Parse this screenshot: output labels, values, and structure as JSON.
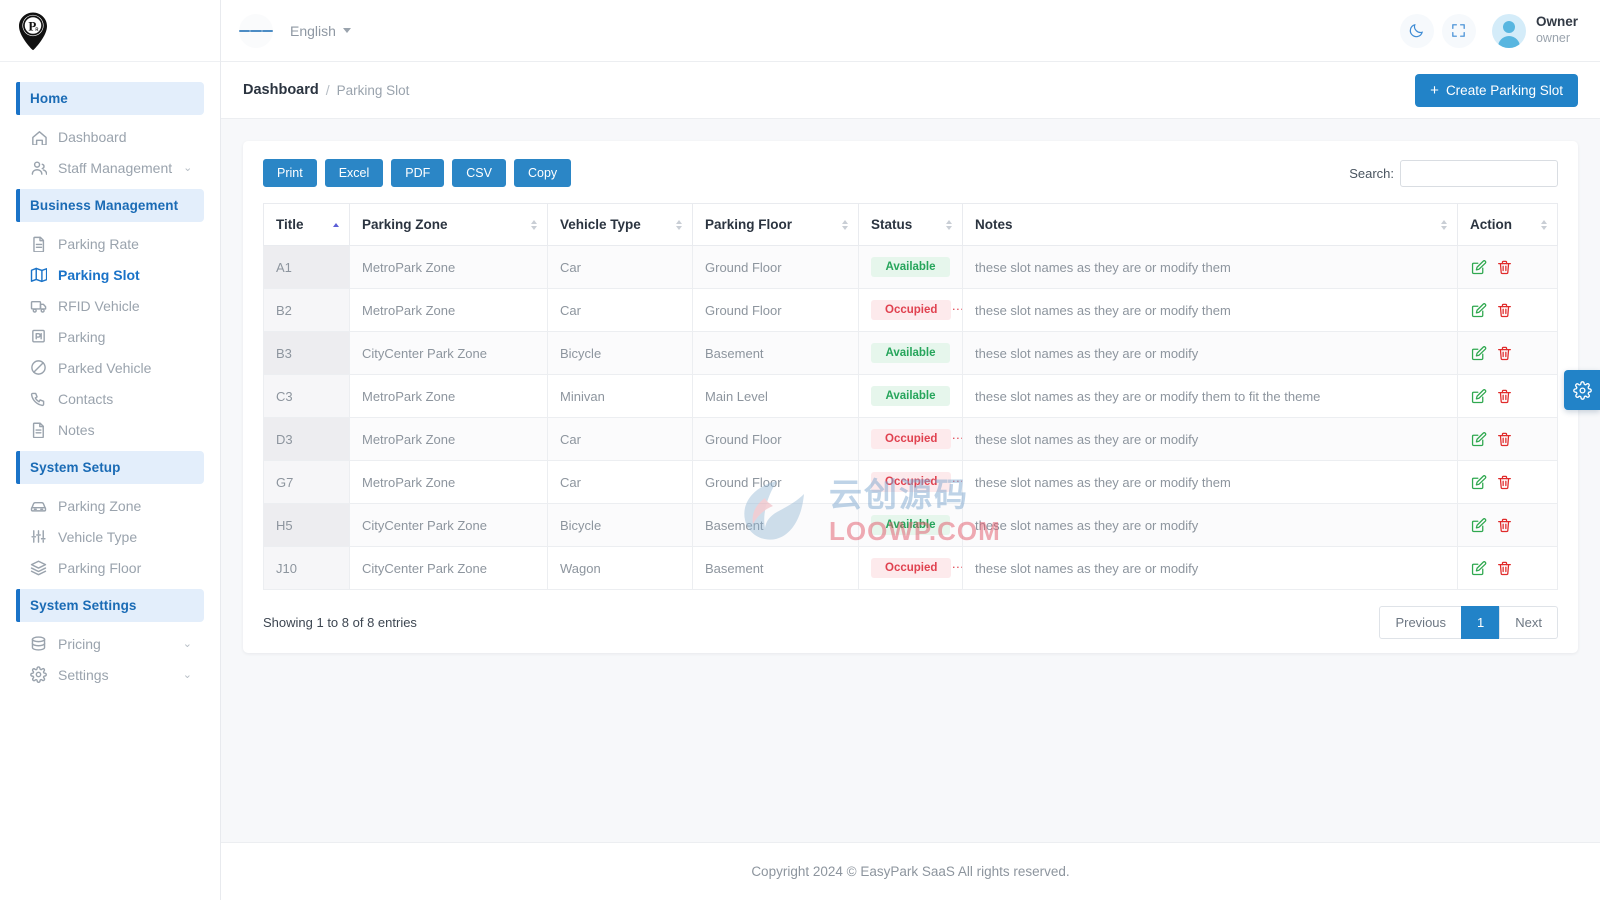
{
  "brand": {
    "logo_alt": "EasyPark parking pin logo"
  },
  "sidebar": {
    "groups": [
      {
        "label": "Home",
        "type": "section"
      },
      {
        "label": "Dashboard",
        "type": "item",
        "icon": "home-icon",
        "active": false,
        "caret": false
      },
      {
        "label": "Staff Management",
        "type": "item",
        "icon": "users-icon",
        "active": false,
        "caret": true
      },
      {
        "label": "Business Management",
        "type": "section"
      },
      {
        "label": "Parking Rate",
        "type": "item",
        "icon": "document-icon",
        "active": false,
        "caret": false
      },
      {
        "label": "Parking Slot",
        "type": "item",
        "icon": "map-icon",
        "active": true,
        "caret": false
      },
      {
        "label": "RFID Vehicle",
        "type": "item",
        "icon": "truck-icon",
        "active": false,
        "caret": false
      },
      {
        "label": "Parking",
        "type": "item",
        "icon": "parking-meter-icon",
        "active": false,
        "caret": false
      },
      {
        "label": "Parked Vehicle",
        "type": "item",
        "icon": "no-entry-icon",
        "active": false,
        "caret": false
      },
      {
        "label": "Contacts",
        "type": "item",
        "icon": "phone-icon",
        "active": false,
        "caret": false
      },
      {
        "label": "Notes",
        "type": "item",
        "icon": "note-icon",
        "active": false,
        "caret": false
      },
      {
        "label": "System Setup",
        "type": "section"
      },
      {
        "label": "Parking Zone",
        "type": "item",
        "icon": "car-icon",
        "active": false,
        "caret": false
      },
      {
        "label": "Vehicle Type",
        "type": "item",
        "icon": "sliders-icon",
        "active": false,
        "caret": false
      },
      {
        "label": "Parking Floor",
        "type": "item",
        "icon": "layers-icon",
        "active": false,
        "caret": false
      },
      {
        "label": "System Settings",
        "type": "section"
      },
      {
        "label": "Pricing",
        "type": "item",
        "icon": "database-icon",
        "active": false,
        "caret": true
      },
      {
        "label": "Settings",
        "type": "item",
        "icon": "gear-icon",
        "active": false,
        "caret": true
      }
    ]
  },
  "topbar": {
    "menu_icon": "hamburger-icon",
    "language": "English",
    "theme_icon": "moon-icon",
    "fullscreen_icon": "expand-icon",
    "user_name": "Owner",
    "user_role": "owner"
  },
  "breadcrumb": {
    "parent": "Dashboard",
    "separator": "/",
    "current": "Parking Slot",
    "create_button": "Create Parking Slot",
    "create_icon": "plus-icon"
  },
  "table_tools": {
    "buttons": [
      "Print",
      "Excel",
      "PDF",
      "CSV",
      "Copy"
    ],
    "search_label": "Search:",
    "search_value": "",
    "search_placeholder": ""
  },
  "table": {
    "columns": [
      {
        "label": "Title",
        "sorted": "asc",
        "sortable": true
      },
      {
        "label": "Parking Zone",
        "sorted": "none",
        "sortable": true
      },
      {
        "label": "Vehicle Type",
        "sorted": "none",
        "sortable": true
      },
      {
        "label": "Parking Floor",
        "sorted": "none",
        "sortable": true
      },
      {
        "label": "Status",
        "sorted": "none",
        "sortable": true
      },
      {
        "label": "Notes",
        "sorted": "none",
        "sortable": true
      },
      {
        "label": "Action",
        "sorted": "none",
        "sortable": true
      }
    ],
    "rows": [
      {
        "title": "A1",
        "zone": "MetroPark Zone",
        "vehicle": "Car",
        "floor": "Ground Floor",
        "status": "Available",
        "notes": "these slot names as they are or modify them"
      },
      {
        "title": "B2",
        "zone": "MetroPark Zone",
        "vehicle": "Car",
        "floor": "Ground Floor",
        "status": "Occupied",
        "notes": "these slot names as they are or modify them"
      },
      {
        "title": "B3",
        "zone": "CityCenter Park Zone",
        "vehicle": "Bicycle",
        "floor": "Basement",
        "status": "Available",
        "notes": "these slot names as they are or modify"
      },
      {
        "title": "C3",
        "zone": "MetroPark Zone",
        "vehicle": "Minivan",
        "floor": "Main Level",
        "status": "Available",
        "notes": "these slot names as they are or modify them to fit the theme"
      },
      {
        "title": "D3",
        "zone": "MetroPark Zone",
        "vehicle": "Car",
        "floor": "Ground Floor",
        "status": "Occupied",
        "notes": "these slot names as they are or modify"
      },
      {
        "title": "G7",
        "zone": "MetroPark Zone",
        "vehicle": "Car",
        "floor": "Ground Floor",
        "status": "Occupied",
        "notes": "these slot names as they are or modify them"
      },
      {
        "title": "H5",
        "zone": "CityCenter Park Zone",
        "vehicle": "Bicycle",
        "floor": "Basement",
        "status": "Available",
        "notes": "these slot names as they are or modify"
      },
      {
        "title": "J10",
        "zone": "CityCenter Park Zone",
        "vehicle": "Wagon",
        "floor": "Basement",
        "status": "Occupied",
        "notes": "these slot names as they are or modify"
      }
    ],
    "row_actions": {
      "edit_icon": "edit-pencil-icon",
      "delete_icon": "trash-icon"
    }
  },
  "pagination": {
    "entries_text": "Showing 1 to 8 of 8 entries",
    "previous": "Previous",
    "pages": [
      "1"
    ],
    "current_page": "1",
    "next": "Next"
  },
  "footer": {
    "copyright": "Copyright 2024 © EasyPark SaaS All rights reserved."
  },
  "settings_fab": {
    "icon": "gear-icon"
  },
  "watermark": {
    "cn": "云创源码",
    "en": "LOOWP.COM"
  },
  "colors": {
    "accent": "#2283c8",
    "section_bg": "#e3eefb",
    "available": "#26a55b",
    "available_bg": "#e6f6ec",
    "occupied": "#e0414f",
    "occupied_bg": "#fdeaec",
    "edit": "#2fa84f",
    "delete": "#e02b2b"
  }
}
